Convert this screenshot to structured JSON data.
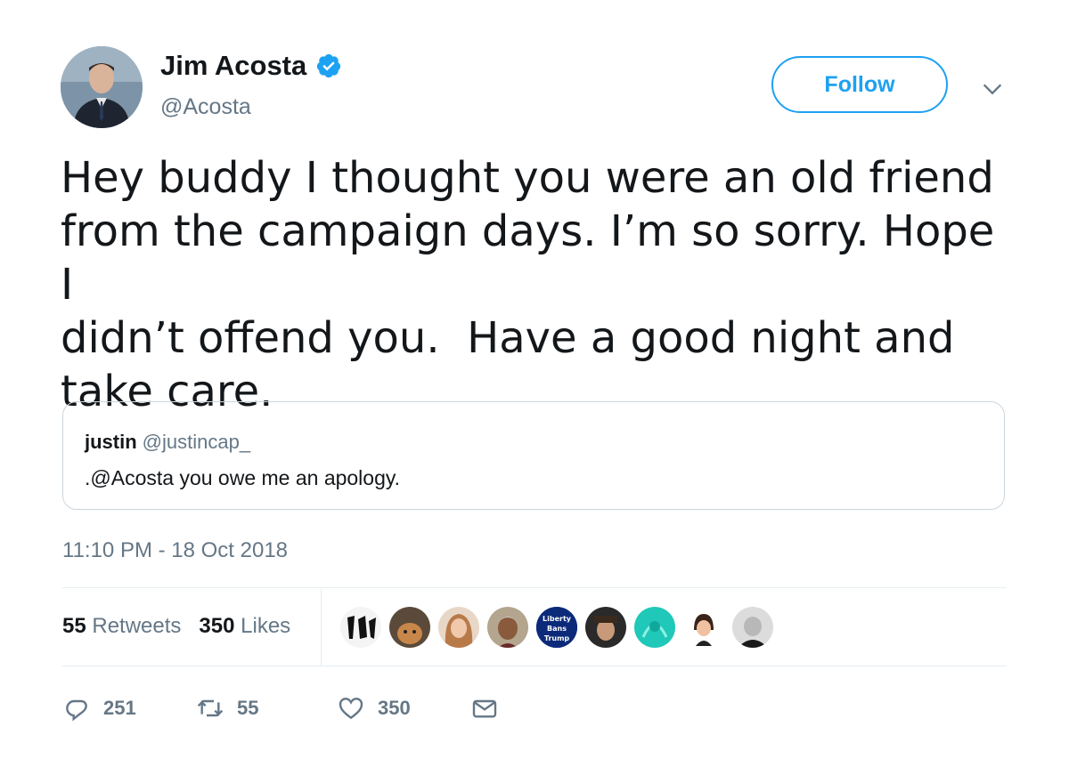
{
  "author": {
    "display_name": "Jim Acosta",
    "handle": "@Acosta"
  },
  "follow_button": {
    "label": "Follow"
  },
  "tweet": {
    "text": "Hey buddy I thought you were an old friend\nfrom the campaign days. I’m so sorry. Hope I\ndidn’t offend you.  Have a good night and\ntake care."
  },
  "quoted_tweet": {
    "name": "justin",
    "handle": "@justincap_",
    "text": ".@Acosta you owe me an apology."
  },
  "timestamp": "11:10 PM - 18 Oct 2018",
  "stats": {
    "retweets_count": "55",
    "retweets_label": "Retweets",
    "likes_count": "350",
    "likes_label": "Likes"
  },
  "liker_badge_text": "Liberty Bans Trump",
  "actions": {
    "replies": "251",
    "retweets": "55",
    "likes": "350"
  },
  "colors": {
    "accent": "#1da1f2",
    "secondary_text": "#657786",
    "border": "#ccd6dd"
  },
  "icons": [
    "verified-badge-icon",
    "chevron-down-icon",
    "reply-icon",
    "retweet-icon",
    "like-icon",
    "message-icon"
  ]
}
